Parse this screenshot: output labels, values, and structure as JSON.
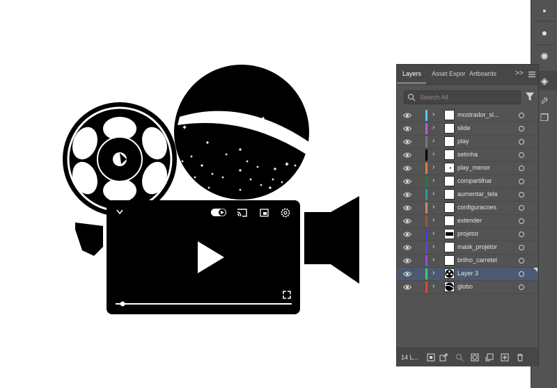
{
  "panel": {
    "tabs": [
      {
        "label": "Layers"
      },
      {
        "label": "Asset Expor"
      },
      {
        "label": "Artboards"
      }
    ],
    "expand_label": ">>",
    "menu_icon": "hamburger-menu-icon",
    "search": {
      "placeholder": "Search All",
      "value": ""
    },
    "filter_icon": "filter-icon",
    "layers": [
      {
        "name": "mostrador_sl...",
        "color": "#5ac8e8",
        "thumb": "blank",
        "selected": false
      },
      {
        "name": "slide",
        "color": "#b660d8",
        "thumb": "blank",
        "selected": false
      },
      {
        "name": "play",
        "color": "#7a7a7a",
        "thumb": "blank",
        "selected": false
      },
      {
        "name": "setinha",
        "color": "#000000",
        "thumb": "blank",
        "selected": false
      },
      {
        "name": "play_menor",
        "color": "#e87a3c",
        "thumb": "dot",
        "selected": false
      },
      {
        "name": "compartilhar",
        "color": "#2a7a3c",
        "thumb": "blank",
        "selected": false
      },
      {
        "name": "aumentar_tela",
        "color": "#2e9a9a",
        "thumb": "blank",
        "selected": false
      },
      {
        "name": "configuracoes",
        "color": "#c0906a",
        "thumb": "blank",
        "selected": false
      },
      {
        "name": "extender",
        "color": "#9a5a3a",
        "thumb": "blank",
        "selected": false
      },
      {
        "name": "projetor",
        "color": "#3f3fd8",
        "thumb": "projector",
        "selected": false
      },
      {
        "name": "mask_projetor",
        "color": "#6a42c8",
        "thumb": "blank",
        "selected": false
      },
      {
        "name": "brilho_carretel",
        "color": "#9a4ad8",
        "thumb": "blank",
        "selected": false
      },
      {
        "name": "Layer 3",
        "color": "#4ac86a",
        "thumb": "reel",
        "selected": true
      },
      {
        "name": "globo",
        "color": "#d84a3a",
        "thumb": "globe",
        "selected": false
      }
    ],
    "footer": {
      "count_label": "14 L...",
      "buttons": [
        "collect-for-export-icon",
        "export-icon",
        "locate-object-icon",
        "make-clipping-mask-icon",
        "new-sublayer-icon",
        "new-layer-icon",
        "delete-icon"
      ]
    }
  },
  "artwork": {
    "description_icon": "film-projector-illustration",
    "video_controls": [
      "toggle-icon",
      "cast-icon",
      "miniplayer-icon",
      "settings-gear-icon",
      "chevron-down-icon",
      "play-icon",
      "fullscreen-icon",
      "progress-slider"
    ],
    "progress": 0.04
  },
  "colors": {
    "panel_bg": "#535353",
    "panel_header": "#474747",
    "selection": "#4b5a72",
    "artwork": "#000000"
  }
}
